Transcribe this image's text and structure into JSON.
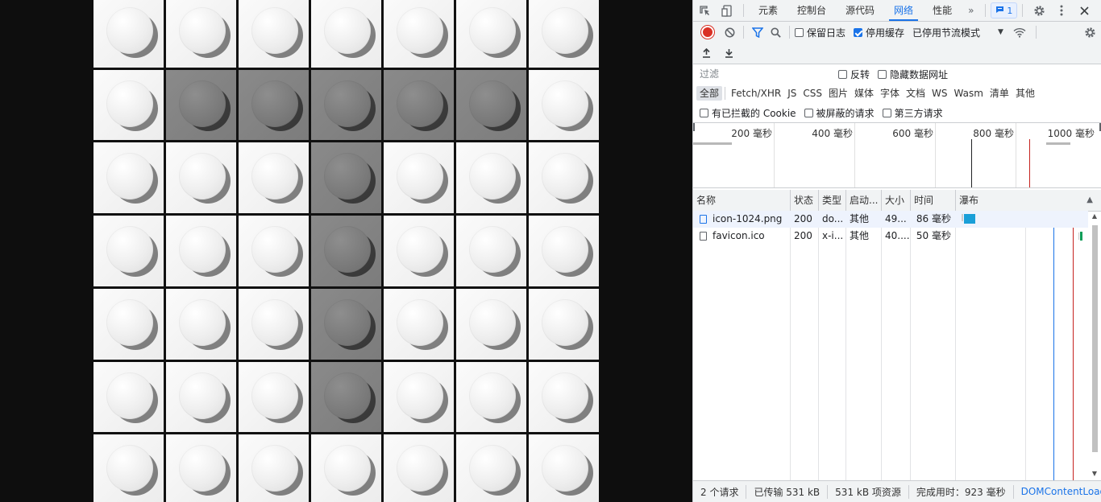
{
  "image_grid": {
    "rows": 7,
    "cols": 7,
    "dark_cells": [
      [
        1,
        1
      ],
      [
        1,
        2
      ],
      [
        1,
        3
      ],
      [
        1,
        4
      ],
      [
        1,
        5
      ],
      [
        2,
        3
      ],
      [
        3,
        3
      ],
      [
        4,
        3
      ],
      [
        5,
        3
      ]
    ]
  },
  "devtools": {
    "tabs": [
      "元素",
      "控制台",
      "源代码",
      "网络",
      "性能"
    ],
    "active_tab": "网络",
    "more_tabs": "»",
    "issues_count": "1",
    "toolbar": {
      "preserve_log": "保留日志",
      "disable_cache": "停用缓存",
      "throttling": "已停用节流模式"
    },
    "filter": {
      "placeholder": "过滤",
      "invert": "反转",
      "hide_data_urls": "隐藏数据网址"
    },
    "types": [
      "全部",
      "Fetch/XHR",
      "JS",
      "CSS",
      "图片",
      "媒体",
      "字体",
      "文档",
      "WS",
      "Wasm",
      "清单",
      "其他"
    ],
    "cookie_filters": [
      "有已拦截的 Cookie",
      "被屏蔽的请求",
      "第三方请求"
    ],
    "overview_ticks": [
      "200 毫秒",
      "400 毫秒",
      "600 毫秒",
      "800 毫秒",
      "1000 毫秒"
    ],
    "columns": [
      "名称",
      "状态",
      "类型",
      "启动...",
      "大小",
      "时间",
      "瀑布"
    ],
    "requests": [
      {
        "name": "icon-1024.png",
        "status": "200",
        "type": "do...",
        "initiator": "其他",
        "size": "49...",
        "time": "86 毫秒"
      },
      {
        "name": "favicon.ico",
        "status": "200",
        "type": "x-i...",
        "initiator": "其他",
        "size": "40....",
        "time": "50 毫秒"
      }
    ],
    "status": {
      "requests": "2 个请求",
      "transferred": "已传输 531 kB",
      "resources": "531 kB 项资源",
      "finish": "完成用时：923 毫秒",
      "dcl": "DOMContentLoaded: "
    },
    "colors": {
      "accent": "#1a73e8",
      "record": "#d93025",
      "dcl_line": "#1a73e8",
      "load_line": "#c5221f",
      "waterfall_bar": "#1a9fd8",
      "waterfall_green": "#0f9d58"
    }
  }
}
